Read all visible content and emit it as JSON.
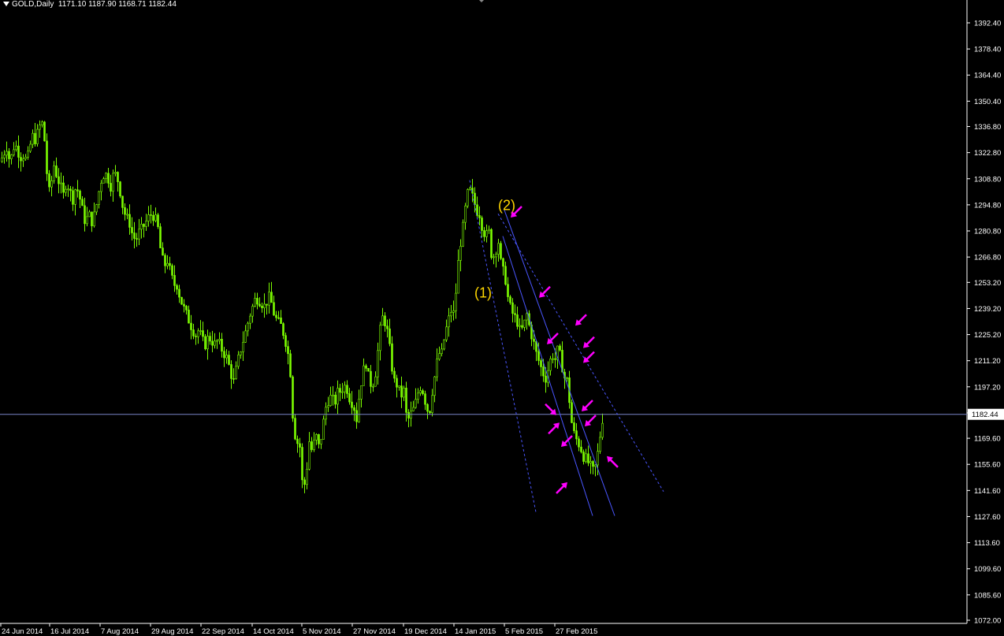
{
  "header": {
    "symbol": "GOLD,Daily",
    "ohlc": "1171.10 1187.90 1168.71 1182.44"
  },
  "colors": {
    "background": "#000000",
    "candle": "#7CFC00",
    "grid_text": "#ffffff",
    "bid_line": "#7a86c8",
    "trendline": "#4a56ff",
    "arrow": "#ff00ff",
    "label": "#ffd700"
  },
  "chart_data": {
    "type": "candlestick",
    "title": "GOLD,Daily",
    "ylim": [
      1068.4,
      1399.6
    ],
    "yticks": [
      1392.4,
      1378.4,
      1364.4,
      1350.4,
      1336.8,
      1322.8,
      1308.8,
      1294.8,
      1280.8,
      1266.8,
      1253.2,
      1239.2,
      1225.2,
      1211.2,
      1197.2,
      1183.2,
      1169.6,
      1155.6,
      1141.6,
      1127.6,
      1113.6,
      1099.6,
      1085.6,
      1072.0
    ],
    "ytick_labels": [
      "1392.40",
      "1378.40",
      "1364.40",
      "1350.40",
      "1336.80",
      "1322.80",
      "1308.80",
      "1294.80",
      "1280.80",
      "1266.80",
      "1253.20",
      "1239.20",
      "1225.20",
      "1211.20",
      "1197.20",
      "1183.20",
      "1169.60",
      "1155.60",
      "1141.60",
      "1127.60",
      "1113.60",
      "1099.60",
      "1085.60",
      "1072.00"
    ],
    "xticks": [
      "24 Jun 2014",
      "16 Jul 2014",
      "7 Aug 2014",
      "29 Aug 2014",
      "22 Sep 2014",
      "14 Oct 2014",
      "5 Nov 2014",
      "27 Nov 2014",
      "19 Dec 2014",
      "14 Jan 2015",
      "5 Feb 2015",
      "27 Feb 2015"
    ],
    "current_price": 1182.44,
    "current_price_label": "1182.44",
    "close_path": [
      [
        0,
        1318
      ],
      [
        4,
        1322
      ],
      [
        8,
        1326
      ],
      [
        12,
        1318
      ],
      [
        15,
        1322
      ],
      [
        18,
        1328
      ],
      [
        21,
        1325
      ],
      [
        24,
        1322
      ],
      [
        27,
        1320
      ],
      [
        30,
        1322
      ],
      [
        33,
        1318
      ],
      [
        36,
        1322
      ],
      [
        40,
        1332
      ],
      [
        44,
        1330
      ],
      [
        48,
        1334
      ],
      [
        52,
        1340
      ],
      [
        55,
        1335
      ],
      [
        58,
        1318
      ],
      [
        61,
        1300
      ],
      [
        64,
        1305
      ],
      [
        68,
        1316
      ],
      [
        72,
        1310
      ],
      [
        76,
        1305
      ],
      [
        80,
        1300
      ],
      [
        84,
        1308
      ],
      [
        88,
        1302
      ],
      [
        92,
        1298
      ],
      [
        96,
        1305
      ],
      [
        100,
        1300
      ],
      [
        104,
        1292
      ],
      [
        108,
        1285
      ],
      [
        112,
        1290
      ],
      [
        116,
        1286
      ],
      [
        120,
        1290
      ],
      [
        124,
        1300
      ],
      [
        128,
        1308
      ],
      [
        132,
        1312
      ],
      [
        136,
        1310
      ],
      [
        140,
        1305
      ],
      [
        144,
        1312
      ],
      [
        148,
        1310
      ],
      [
        152,
        1302
      ],
      [
        156,
        1292
      ],
      [
        160,
        1288
      ],
      [
        164,
        1285
      ],
      [
        168,
        1278
      ],
      [
        172,
        1276
      ],
      [
        176,
        1280
      ],
      [
        180,
        1282
      ],
      [
        184,
        1285
      ],
      [
        188,
        1288
      ],
      [
        192,
        1290
      ],
      [
        196,
        1288
      ],
      [
        200,
        1282
      ],
      [
        204,
        1268
      ],
      [
        208,
        1262
      ],
      [
        212,
        1265
      ],
      [
        216,
        1258
      ],
      [
        220,
        1252
      ],
      [
        224,
        1252
      ],
      [
        228,
        1245
      ],
      [
        232,
        1240
      ],
      [
        236,
        1236
      ],
      [
        240,
        1232
      ],
      [
        244,
        1228
      ],
      [
        248,
        1225
      ],
      [
        252,
        1228
      ],
      [
        256,
        1222
      ],
      [
        260,
        1220
      ],
      [
        264,
        1224
      ],
      [
        268,
        1222
      ],
      [
        272,
        1220
      ],
      [
        276,
        1222
      ],
      [
        280,
        1218
      ],
      [
        284,
        1215
      ],
      [
        288,
        1212
      ],
      [
        292,
        1205
      ],
      [
        296,
        1200
      ],
      [
        300,
        1208
      ],
      [
        304,
        1216
      ],
      [
        308,
        1222
      ],
      [
        312,
        1228
      ],
      [
        316,
        1235
      ],
      [
        320,
        1240
      ],
      [
        324,
        1245
      ],
      [
        328,
        1244
      ],
      [
        332,
        1242
      ],
      [
        336,
        1240
      ],
      [
        340,
        1246
      ],
      [
        344,
        1242
      ],
      [
        348,
        1235
      ],
      [
        352,
        1232
      ],
      [
        356,
        1230
      ],
      [
        360,
        1225
      ],
      [
        364,
        1218
      ],
      [
        368,
        1205
      ],
      [
        372,
        1175
      ],
      [
        376,
        1168
      ],
      [
        380,
        1165
      ],
      [
        384,
        1140
      ],
      [
        388,
        1150
      ],
      [
        392,
        1168
      ],
      [
        396,
        1162
      ],
      [
        400,
        1172
      ],
      [
        404,
        1165
      ],
      [
        408,
        1172
      ],
      [
        412,
        1185
      ],
      [
        416,
        1190
      ],
      [
        420,
        1192
      ],
      [
        424,
        1188
      ],
      [
        428,
        1194
      ],
      [
        432,
        1195
      ],
      [
        436,
        1198
      ],
      [
        440,
        1196
      ],
      [
        444,
        1190
      ],
      [
        448,
        1188
      ],
      [
        452,
        1180
      ],
      [
        456,
        1195
      ],
      [
        460,
        1205
      ],
      [
        464,
        1210
      ],
      [
        468,
        1200
      ],
      [
        472,
        1198
      ],
      [
        476,
        1205
      ],
      [
        480,
        1220
      ],
      [
        484,
        1235
      ],
      [
        488,
        1232
      ],
      [
        492,
        1225
      ],
      [
        496,
        1210
      ],
      [
        500,
        1200
      ],
      [
        504,
        1198
      ],
      [
        508,
        1192
      ],
      [
        512,
        1195
      ],
      [
        516,
        1178
      ],
      [
        520,
        1182
      ],
      [
        524,
        1185
      ],
      [
        528,
        1190
      ],
      [
        532,
        1198
      ],
      [
        536,
        1195
      ],
      [
        540,
        1188
      ],
      [
        544,
        1182
      ],
      [
        548,
        1195
      ],
      [
        552,
        1205
      ],
      [
        556,
        1215
      ],
      [
        560,
        1215
      ],
      [
        564,
        1225
      ],
      [
        568,
        1232
      ],
      [
        572,
        1238
      ],
      [
        576,
        1236
      ],
      [
        580,
        1260
      ],
      [
        584,
        1275
      ],
      [
        588,
        1285
      ],
      [
        592,
        1300
      ],
      [
        596,
        1302
      ],
      [
        600,
        1298
      ],
      [
        604,
        1292
      ],
      [
        608,
        1290
      ],
      [
        612,
        1282
      ],
      [
        616,
        1278
      ],
      [
        620,
        1280
      ],
      [
        624,
        1265
      ],
      [
        628,
        1270
      ],
      [
        632,
        1275
      ],
      [
        636,
        1260
      ],
      [
        640,
        1258
      ],
      [
        644,
        1245
      ],
      [
        648,
        1238
      ],
      [
        652,
        1235
      ],
      [
        656,
        1232
      ],
      [
        660,
        1226
      ],
      [
        664,
        1230
      ],
      [
        668,
        1236
      ],
      [
        672,
        1228
      ],
      [
        676,
        1222
      ],
      [
        680,
        1215
      ],
      [
        684,
        1210
      ],
      [
        688,
        1205
      ],
      [
        692,
        1202
      ],
      [
        696,
        1208
      ],
      [
        700,
        1215
      ],
      [
        704,
        1212
      ],
      [
        708,
        1218
      ],
      [
        712,
        1210
      ],
      [
        716,
        1202
      ],
      [
        720,
        1200
      ],
      [
        724,
        1180
      ],
      [
        728,
        1172
      ],
      [
        732,
        1168
      ],
      [
        736,
        1165
      ],
      [
        740,
        1160
      ],
      [
        744,
        1158
      ],
      [
        748,
        1155
      ],
      [
        752,
        1152
      ],
      [
        756,
        1155
      ],
      [
        760,
        1168
      ],
      [
        764,
        1180
      ],
      [
        766,
        1182
      ]
    ],
    "trendlines": [
      {
        "style": "dashed",
        "p1": [
          1308,
          596
        ],
        "p2": [
          1130,
          680
        ]
      },
      {
        "style": "dashed",
        "p1": [
          1290,
          632
        ],
        "p2": [
          1141,
          842
        ]
      },
      {
        "style": "solid",
        "p1": [
          1278,
          638
        ],
        "p2": [
          1128,
          752
        ]
      },
      {
        "style": "solid",
        "p1": [
          1292,
          640
        ],
        "p2": [
          1128,
          780
        ]
      }
    ],
    "labels": [
      {
        "text": "(2)",
        "at": [
          632,
          1292
        ]
      },
      {
        "text": "(1)",
        "at": [
          602,
          1245
        ]
      }
    ],
    "arrows": [
      {
        "at": [
          648,
          1288
        ],
        "dir": "sw"
      },
      {
        "at": [
          684,
          1245
        ],
        "dir": "sw"
      },
      {
        "at": [
          730,
          1230
        ],
        "dir": "sw"
      },
      {
        "at": [
          740,
          1218
        ],
        "dir": "sw"
      },
      {
        "at": [
          740,
          1210
        ],
        "dir": "sw"
      },
      {
        "at": [
          694,
          1220
        ],
        "dir": "sw"
      },
      {
        "at": [
          706,
          1182
        ],
        "dir": "se"
      },
      {
        "at": [
          710,
          1178
        ],
        "dir": "ne"
      },
      {
        "at": [
          738,
          1184
        ],
        "dir": "sw"
      },
      {
        "at": [
          742,
          1176
        ],
        "dir": "sw"
      },
      {
        "at": [
          712,
          1165
        ],
        "dir": "sw"
      },
      {
        "at": [
          770,
          1160
        ],
        "dir": "nw"
      },
      {
        "at": [
          720,
          1146
        ],
        "dir": "ne"
      }
    ]
  }
}
